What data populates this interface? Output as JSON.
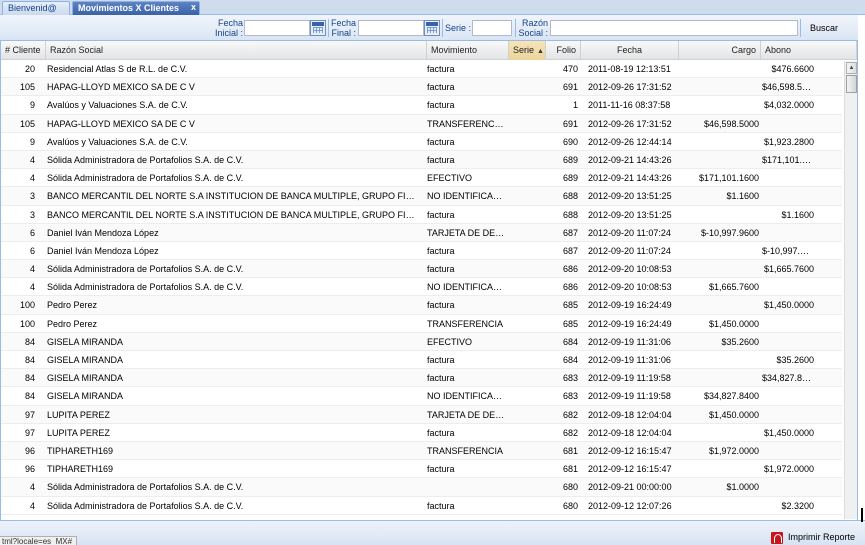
{
  "tabs": [
    {
      "label": "Bienvenid@"
    },
    {
      "label": "Movimientos X Clientes",
      "close": "x"
    }
  ],
  "toolbar": {
    "fecha_inicial_label_1": "Fecha",
    "fecha_inicial_label_2": "Inicial :",
    "fecha_inicial_value": "",
    "fecha_final_label_1": "Fecha",
    "fecha_final_label_2": "Final :",
    "fecha_final_value": "",
    "serie_label": "Serie :",
    "serie_value": "",
    "razon_label_1": "Razón",
    "razon_label_2": "Social :",
    "razon_value": "",
    "buscar_label": "Buscar"
  },
  "grid": {
    "columns": [
      "# Cliente",
      "Razón Social",
      "Movimiento",
      "Serie",
      "Folio",
      "Fecha",
      "Cargo",
      "Abono"
    ],
    "sorted_column": "Serie",
    "rows": [
      {
        "cliente": "20",
        "razon": "Residencial Atlas S de R.L. de C.V.",
        "mov": "factura",
        "serie": "",
        "folio": "470",
        "fecha": "2011-08-19 12:13:51",
        "cargo": "",
        "abono": "$476.6600"
      },
      {
        "cliente": "105",
        "razon": "HAPAG-LLOYD MEXICO SA DE C V",
        "mov": "factura",
        "serie": "",
        "folio": "691",
        "fecha": "2012-09-26 17:31:52",
        "cargo": "",
        "abono": "$46,598.5000"
      },
      {
        "cliente": "9",
        "razon": "Avalúos y Valuaciones S.A. de C.V.",
        "mov": "factura",
        "serie": "",
        "folio": "1",
        "fecha": "2011-11-16 08:37:58",
        "cargo": "",
        "abono": "$4,032.0000"
      },
      {
        "cliente": "105",
        "razon": "HAPAG-LLOYD MEXICO SA DE C V",
        "mov": "TRANSFERENCIA ...",
        "serie": "",
        "folio": "691",
        "fecha": "2012-09-26 17:31:52",
        "cargo": "$46,598.5000",
        "abono": ""
      },
      {
        "cliente": "9",
        "razon": "Avalúos y Valuaciones S.A. de C.V.",
        "mov": "factura",
        "serie": "",
        "folio": "690",
        "fecha": "2012-09-26 12:44:14",
        "cargo": "",
        "abono": "$1,923.2800"
      },
      {
        "cliente": "4",
        "razon": "Sólida Administradora de Portafolios S.A. de C.V.",
        "mov": "factura",
        "serie": "",
        "folio": "689",
        "fecha": "2012-09-21 14:43:26",
        "cargo": "",
        "abono": "$171,101.1600"
      },
      {
        "cliente": "4",
        "razon": "Sólida Administradora de Portafolios S.A. de C.V.",
        "mov": "EFECTIVO",
        "serie": "",
        "folio": "689",
        "fecha": "2012-09-21 14:43:26",
        "cargo": "$171,101.1600",
        "abono": ""
      },
      {
        "cliente": "3",
        "razon": "BANCO MERCANTIL DEL NORTE S.A INSTITUCION DE BANCA MULTIPLE, GRUPO FINANCIER...",
        "mov": "NO IDENTIFICADO",
        "serie": "",
        "folio": "688",
        "fecha": "2012-09-20 13:51:25",
        "cargo": "$1.1600",
        "abono": ""
      },
      {
        "cliente": "3",
        "razon": "BANCO MERCANTIL DEL NORTE S.A INSTITUCION DE BANCA MULTIPLE, GRUPO FINANCIER...",
        "mov": "factura",
        "serie": "",
        "folio": "688",
        "fecha": "2012-09-20 13:51:25",
        "cargo": "",
        "abono": "$1.1600"
      },
      {
        "cliente": "6",
        "razon": "Daniel Iván Mendoza López",
        "mov": "TARJETA DE DEBI...",
        "serie": "",
        "folio": "687",
        "fecha": "2012-09-20 11:07:24",
        "cargo": "$-10,997.9600",
        "abono": ""
      },
      {
        "cliente": "6",
        "razon": "Daniel Iván Mendoza López",
        "mov": "factura",
        "serie": "",
        "folio": "687",
        "fecha": "2012-09-20 11:07:24",
        "cargo": "",
        "abono": "$-10,997.9600"
      },
      {
        "cliente": "4",
        "razon": "Sólida Administradora de Portafolios S.A. de C.V.",
        "mov": "factura",
        "serie": "",
        "folio": "686",
        "fecha": "2012-09-20 10:08:53",
        "cargo": "",
        "abono": "$1,665.7600"
      },
      {
        "cliente": "4",
        "razon": "Sólida Administradora de Portafolios S.A. de C.V.",
        "mov": "NO IDENTIFICADO",
        "serie": "",
        "folio": "686",
        "fecha": "2012-09-20 10:08:53",
        "cargo": "$1,665.7600",
        "abono": ""
      },
      {
        "cliente": "100",
        "razon": "Pedro Perez",
        "mov": "factura",
        "serie": "",
        "folio": "685",
        "fecha": "2012-09-19 16:24:49",
        "cargo": "",
        "abono": "$1,450.0000"
      },
      {
        "cliente": "100",
        "razon": "Pedro Perez",
        "mov": "TRANSFERENCIA",
        "serie": "",
        "folio": "685",
        "fecha": "2012-09-19 16:24:49",
        "cargo": "$1,450.0000",
        "abono": ""
      },
      {
        "cliente": "84",
        "razon": "GISELA MIRANDA",
        "mov": "EFECTIVO",
        "serie": "",
        "folio": "684",
        "fecha": "2012-09-19 11:31:06",
        "cargo": "$35.2600",
        "abono": ""
      },
      {
        "cliente": "84",
        "razon": "GISELA MIRANDA",
        "mov": "factura",
        "serie": "",
        "folio": "684",
        "fecha": "2012-09-19 11:31:06",
        "cargo": "",
        "abono": "$35.2600"
      },
      {
        "cliente": "84",
        "razon": "GISELA MIRANDA",
        "mov": "factura",
        "serie": "",
        "folio": "683",
        "fecha": "2012-09-19 11:19:58",
        "cargo": "",
        "abono": "$34,827.8400"
      },
      {
        "cliente": "84",
        "razon": "GISELA MIRANDA",
        "mov": "NO IDENTIFICADO",
        "serie": "",
        "folio": "683",
        "fecha": "2012-09-19 11:19:58",
        "cargo": "$34,827.8400",
        "abono": ""
      },
      {
        "cliente": "97",
        "razon": "LUPITA PEREZ",
        "mov": "TARJETA DE DEBI...",
        "serie": "",
        "folio": "682",
        "fecha": "2012-09-18 12:04:04",
        "cargo": "$1,450.0000",
        "abono": ""
      },
      {
        "cliente": "97",
        "razon": "LUPITA PEREZ",
        "mov": "factura",
        "serie": "",
        "folio": "682",
        "fecha": "2012-09-18 12:04:04",
        "cargo": "",
        "abono": "$1,450.0000"
      },
      {
        "cliente": "96",
        "razon": "TIPHARETH169",
        "mov": "TRANSFERENCIA",
        "serie": "",
        "folio": "681",
        "fecha": "2012-09-12 16:15:47",
        "cargo": "$1,972.0000",
        "abono": ""
      },
      {
        "cliente": "96",
        "razon": "TIPHARETH169",
        "mov": "factura",
        "serie": "",
        "folio": "681",
        "fecha": "2012-09-12 16:15:47",
        "cargo": "",
        "abono": "$1,972.0000"
      },
      {
        "cliente": "4",
        "razon": "Sólida Administradora de Portafolios S.A. de C.V.",
        "mov": "",
        "serie": "",
        "folio": "680",
        "fecha": "2012-09-21 00:00:00",
        "cargo": "$1.0000",
        "abono": ""
      },
      {
        "cliente": "4",
        "razon": "Sólida Administradora de Portafolios S.A. de C.V.",
        "mov": "factura",
        "serie": "",
        "folio": "680",
        "fecha": "2012-09-12 12:07:26",
        "cargo": "",
        "abono": "$2.3200"
      }
    ]
  },
  "footer": {
    "status_url": "tml?locale=es_MX#",
    "print_label": "Imprimir Reporte"
  },
  "colors": {
    "accent": "#3a62a8",
    "border": "#99bbe8",
    "sorted_header": "#ecd49c",
    "pdf_red": "#c8161d"
  }
}
